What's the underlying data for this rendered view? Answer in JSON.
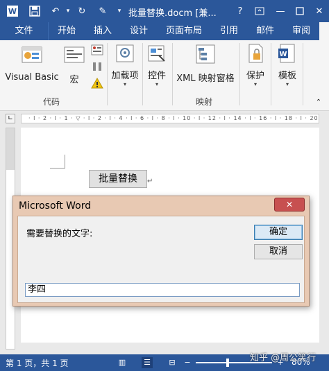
{
  "titlebar": {
    "title": "批量替换.docm [兼...",
    "help": "?",
    "restore_icon": "ribbon-display-icon"
  },
  "tabs": [
    {
      "label": "文件"
    },
    {
      "label": "开始"
    },
    {
      "label": "插入"
    },
    {
      "label": "设计"
    },
    {
      "label": "页面布局"
    },
    {
      "label": "引用"
    },
    {
      "label": "邮件"
    },
    {
      "label": "审阅"
    }
  ],
  "ribbon": {
    "code_group": {
      "label": "代码",
      "visual_basic": "Visual Basic",
      "macro": "宏"
    },
    "addins_label": "加载项",
    "controls_label": "控件",
    "mapping_group": {
      "label": "映射",
      "xml_pane": "XML 映射窗格"
    },
    "protect_label": "保护",
    "template_label": "模板"
  },
  "document": {
    "button_text": "批量替换"
  },
  "dialog": {
    "title": "Microsoft Word",
    "prompt": "需要替换的文字:",
    "ok_label": "确定",
    "cancel_label": "取消",
    "input_value": "李四"
  },
  "statusbar": {
    "page_info": "第 1 页，共 1 页",
    "zoom": "80%",
    "watermark": "知乎 @周公笑行"
  }
}
